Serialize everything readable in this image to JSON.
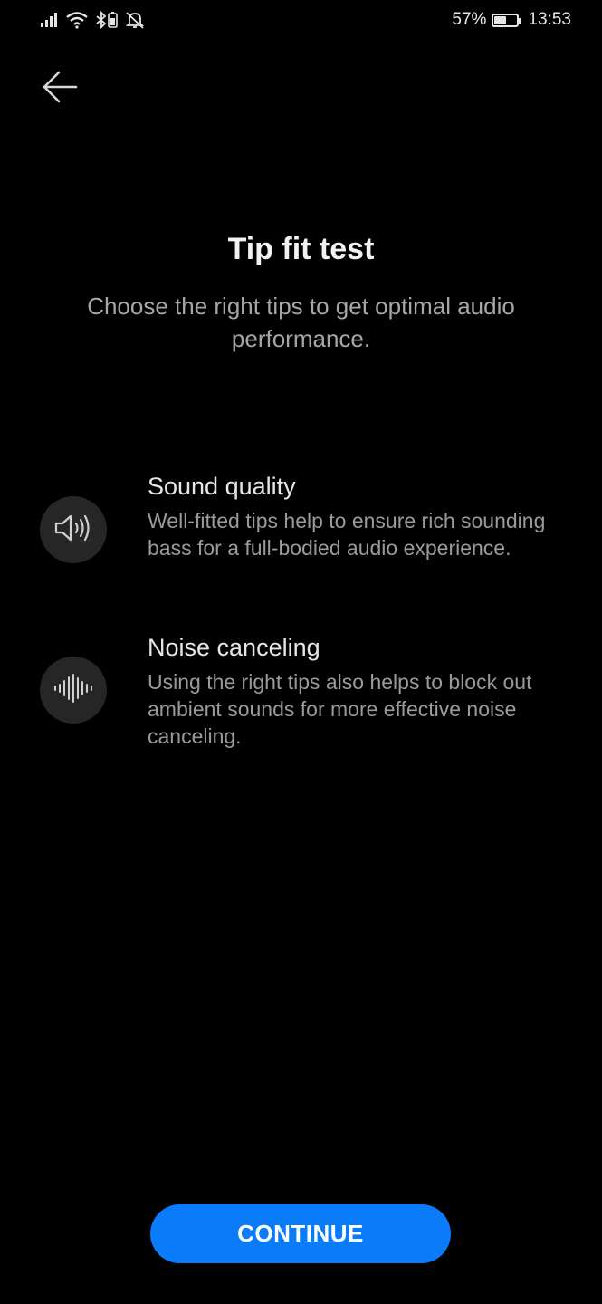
{
  "status_bar": {
    "battery_percent": "57%",
    "battery_level": 0.57,
    "time": "13:53",
    "icons": [
      "signal-icon",
      "wifi-icon",
      "bluetooth-battery-icon",
      "notifications-off-icon",
      "battery-icon"
    ]
  },
  "header": {
    "back_icon": "arrow-left-icon"
  },
  "main": {
    "title": "Tip fit test",
    "subtitle": "Choose the right tips to get optimal audio performance.",
    "features": [
      {
        "icon": "speaker-volume-icon",
        "title": "Sound quality",
        "description": "Well-fitted tips help to ensure rich sounding bass for a full-bodied audio experience."
      },
      {
        "icon": "sound-wave-icon",
        "title": "Noise canceling",
        "description": "Using the right tips also helps to block out ambient sounds for more effective noise canceling."
      }
    ]
  },
  "footer": {
    "continue_label": "CONTINUE"
  },
  "colors": {
    "background": "#000000",
    "accent": "#0a7cfa",
    "icon_circle": "#262626"
  }
}
